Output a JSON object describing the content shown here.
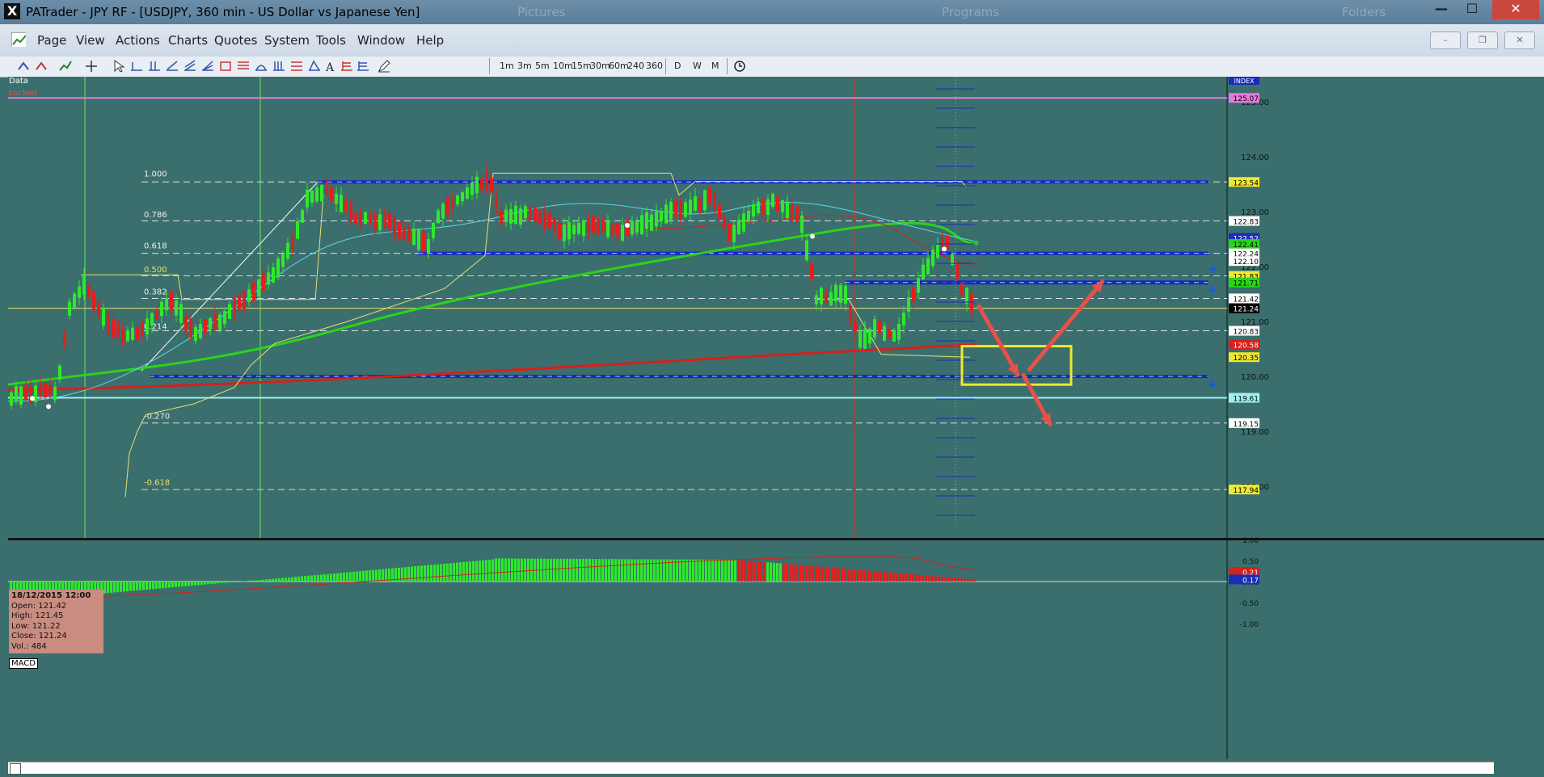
{
  "window": {
    "title": "PATrader - JPY RF - [USDJPY, 360 min - US Dollar vs Japanese Yen]",
    "ghost_tabs": [
      "Pictures",
      "Programs",
      "Folders"
    ],
    "buttons": {
      "minimize": "—",
      "maximize": "☐",
      "close": "✕"
    }
  },
  "menu": {
    "items": [
      "Page",
      "View",
      "Actions",
      "Charts",
      "Quotes",
      "System",
      "Tools",
      "Window",
      "Help"
    ],
    "mdi": {
      "minimize": "–",
      "restore": "❐",
      "close": "✕"
    }
  },
  "toolbar": {
    "timeframes": [
      "1m",
      "3m",
      "5m",
      "10m",
      "15m",
      "30m",
      "60m",
      "240",
      "360"
    ],
    "periods": [
      "D",
      "W",
      "M"
    ]
  },
  "chart": {
    "data_tag": "Data",
    "locked_tag": "Locked",
    "index_label": "INDEX",
    "macd_label": "MACD",
    "fib_labels": [
      "1.000",
      "0.786",
      "0.618",
      "0.500",
      "0.382",
      "0.214",
      "-0.270",
      "-0.618"
    ],
    "price_ticks": [
      "125.00",
      "124.00",
      "123.00",
      "122.00",
      "121.00",
      "120.00",
      "119.00",
      "118.00"
    ],
    "macd_ticks": [
      "1.00",
      "0.50",
      "0.00",
      "-0.50",
      "-1.00"
    ],
    "price_badges": [
      {
        "text": "125.07",
        "bg": "#e878e0",
        "fg": "#000"
      },
      {
        "text": "123.54",
        "bg": "#f0e830",
        "fg": "#000"
      },
      {
        "text": "122.83",
        "bg": "#ffffff",
        "fg": "#000"
      },
      {
        "text": "122.52",
        "bg": "#1a2db8",
        "fg": "#fff"
      },
      {
        "text": "122.41",
        "bg": "#2ad41a",
        "fg": "#000"
      },
      {
        "text": "122.24",
        "bg": "#ffffff",
        "fg": "#000"
      },
      {
        "text": "122.10",
        "bg": "#ffffff",
        "fg": "#000"
      },
      {
        "text": "121.83",
        "bg": "#f0e830",
        "fg": "#000"
      },
      {
        "text": "121.71",
        "bg": "#2ad41a",
        "fg": "#000"
      },
      {
        "text": "121.42",
        "bg": "#ffffff",
        "fg": "#000"
      },
      {
        "text": "121.24",
        "bg": "#000000",
        "fg": "#fff"
      },
      {
        "text": "120.83",
        "bg": "#ffffff",
        "fg": "#000"
      },
      {
        "text": "120.58",
        "bg": "#d8201a",
        "fg": "#fff"
      },
      {
        "text": "120.35",
        "bg": "#f0e830",
        "fg": "#000"
      },
      {
        "text": "119.61",
        "bg": "#9ef0f0",
        "fg": "#000"
      },
      {
        "text": "119.15",
        "bg": "#ffffff",
        "fg": "#000"
      },
      {
        "text": "117.94",
        "bg": "#f0e830",
        "fg": "#000"
      }
    ],
    "macd_badges": [
      {
        "text": "0.21",
        "bg": "#d8201a",
        "fg": "#fff"
      },
      {
        "text": "0.17",
        "bg": "#1a2db8",
        "fg": "#fff"
      }
    ],
    "tooltip": {
      "date": "18/12/2015 12:00",
      "open": "Open: 121.42",
      "high": "High: 121.45",
      "low": "Low: 121.22",
      "close": "Close: 121.24",
      "vol": "Vol.: 484"
    },
    "colors": {
      "background": "#3a6f6d",
      "bull": "#2fe82a",
      "bear": "#e41e1e",
      "support_line": "#1428c8",
      "annotation_box": "#f0e830",
      "annotation_arrow": "#e8504a"
    }
  }
}
